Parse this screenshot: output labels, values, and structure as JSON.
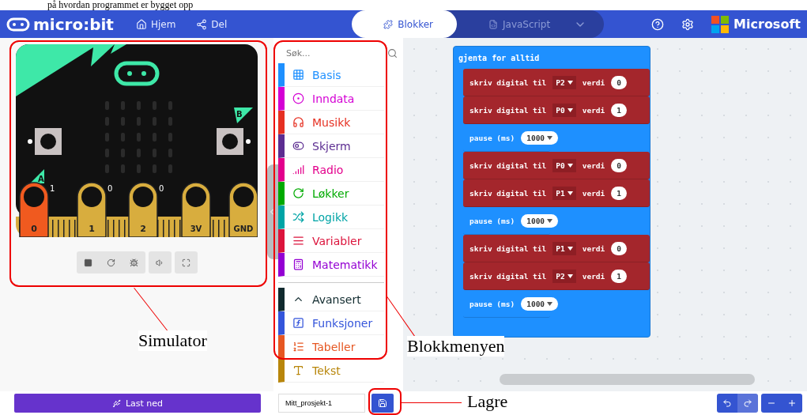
{
  "doc_text": "på hvordan programmet er bygget opp",
  "header": {
    "logo": "micro:bit",
    "nav": [
      {
        "label": "Hjem"
      },
      {
        "label": "Del"
      }
    ],
    "modes": [
      {
        "label": "Blokker",
        "selected": true
      },
      {
        "label": "JavaScript",
        "selected": false
      }
    ],
    "brand": "Microsoft"
  },
  "simulator": {
    "buttons": [
      "A",
      "B"
    ],
    "pins": [
      {
        "label": "0",
        "reading": "1",
        "pressed": true
      },
      {
        "label": "1",
        "reading": "0",
        "pressed": false
      },
      {
        "label": "2",
        "reading": "0",
        "pressed": false
      },
      {
        "label": "3V",
        "pressed": false
      },
      {
        "label": "GND",
        "pressed": false
      }
    ]
  },
  "toolbox": {
    "placeholder": "Søk...",
    "categories": [
      {
        "label": "Basis",
        "color": "#1e90ff"
      },
      {
        "label": "Inndata",
        "color": "#d400d4"
      },
      {
        "label": "Musikk",
        "color": "#e63022"
      },
      {
        "label": "Skjerm",
        "color": "#5c2d91"
      },
      {
        "label": "Radio",
        "color": "#e3008c"
      },
      {
        "label": "Løkker",
        "color": "#00aa00"
      },
      {
        "label": "Logikk",
        "color": "#00a4a6"
      },
      {
        "label": "Variabler",
        "color": "#dc143c"
      },
      {
        "label": "Matematikk",
        "color": "#9400d3"
      },
      {
        "label": "Avansert",
        "color": "#102a2e"
      },
      {
        "label": "Funksjoner",
        "color": "#3455db"
      },
      {
        "label": "Tabeller",
        "color": "#e65722"
      },
      {
        "label": "Tekst",
        "color": "#b8860b"
      }
    ]
  },
  "workspace": {
    "loop": "gjenta for alltid",
    "statements": [
      {
        "kind": "digital_write",
        "text": "skriv digital til",
        "pin": "P2",
        "value_label": "verdi",
        "value": "0"
      },
      {
        "kind": "digital_write",
        "text": "skriv digital til",
        "pin": "P0",
        "value_label": "verdi",
        "value": "1"
      },
      {
        "kind": "pause",
        "text": "pause (ms)",
        "value": "1000"
      },
      {
        "kind": "digital_write",
        "text": "skriv digital til",
        "pin": "P0",
        "value_label": "verdi",
        "value": "0"
      },
      {
        "kind": "digital_write",
        "text": "skriv digital til",
        "pin": "P1",
        "value_label": "verdi",
        "value": "1"
      },
      {
        "kind": "pause",
        "text": "pause (ms)",
        "value": "1000"
      },
      {
        "kind": "digital_write",
        "text": "skriv digital til",
        "pin": "P1",
        "value_label": "verdi",
        "value": "0"
      },
      {
        "kind": "digital_write",
        "text": "skriv digital til",
        "pin": "P2",
        "value_label": "verdi",
        "value": "1"
      },
      {
        "kind": "pause",
        "text": "pause (ms)",
        "value": "1000"
      }
    ]
  },
  "bottom_bar": {
    "download": "Last ned",
    "project_name": "Mitt_prosjekt-1"
  },
  "annotations": [
    {
      "label": "Simulator"
    },
    {
      "label": "Blokkmenyen"
    },
    {
      "label": "Lagre"
    }
  ]
}
